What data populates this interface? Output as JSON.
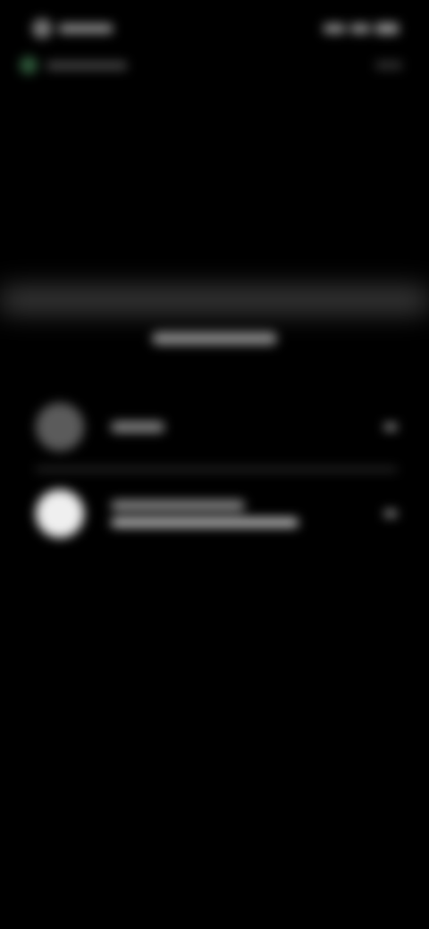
{
  "status_bar": {
    "time": "",
    "signal_icon": "signal-icon",
    "wifi_icon": "wifi-icon",
    "battery_icon": "battery-icon"
  },
  "top_sub": {
    "left_text": "",
    "right_text": ""
  },
  "sheet": {
    "title": "",
    "rows": [
      {
        "title": "",
        "subtitle": ""
      },
      {
        "title": "",
        "subtitle": ""
      }
    ]
  }
}
